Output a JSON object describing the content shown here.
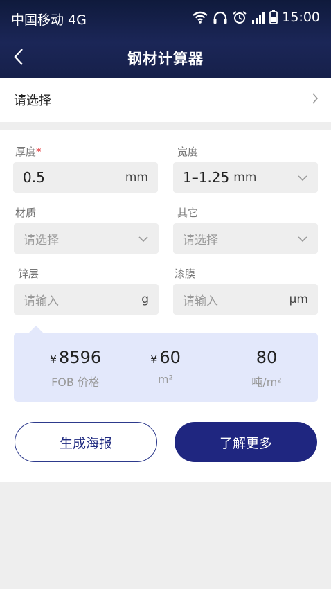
{
  "status_bar": {
    "carrier": "中国移动 4G",
    "time": "15:00",
    "icons": [
      "wifi-icon",
      "headphones-icon",
      "alarm-icon",
      "signal-icon",
      "battery-icon"
    ]
  },
  "nav": {
    "title": "钢材计算器",
    "back_icon": "chevron-left-icon"
  },
  "select_row": {
    "label": "请选择",
    "icon": "chevron-right-icon"
  },
  "form": {
    "thickness": {
      "label": "厚度",
      "required_mark": "*",
      "value": "0.5",
      "unit": "mm"
    },
    "width": {
      "label": "宽度",
      "value": "1–1.25",
      "unit": "mm"
    },
    "material": {
      "label": "材质",
      "placeholder": "请选择"
    },
    "other": {
      "label": "其它",
      "placeholder": "请选择"
    },
    "zinc": {
      "label": "锌层",
      "placeholder": "请输入",
      "unit": "g"
    },
    "paint": {
      "label": "漆膜",
      "placeholder": "请输入",
      "unit": "μm"
    }
  },
  "results": [
    {
      "currency": "¥",
      "value": "8596",
      "label": "FOB 价格"
    },
    {
      "currency": "¥",
      "value": "60",
      "label": "m²"
    },
    {
      "currency": "",
      "value": "80",
      "label": "吨/m²"
    }
  ],
  "buttons": {
    "poster": "生成海报",
    "learn_more": "了解更多"
  },
  "colors": {
    "header": "#1b2657",
    "accent": "#1f2680",
    "result_bg": "#e3e8fb",
    "required": "#e4393c"
  }
}
